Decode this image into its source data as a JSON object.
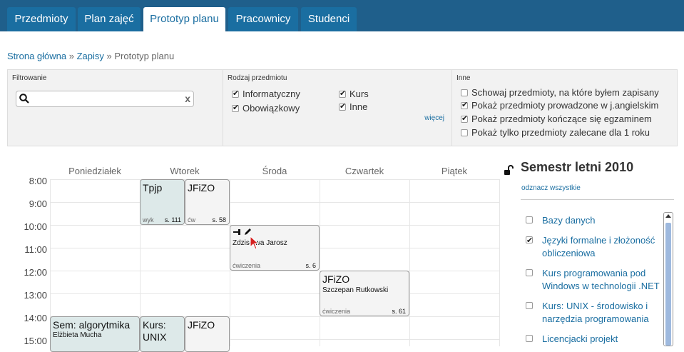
{
  "nav": {
    "tabs": [
      {
        "label": "Przedmioty"
      },
      {
        "label": "Plan zajęć"
      },
      {
        "label": "Prototyp planu"
      },
      {
        "label": "Pracownicy"
      },
      {
        "label": "Studenci"
      }
    ],
    "active": "Prototyp planu"
  },
  "breadcrumb": {
    "home": "Strona główna",
    "sep": "»",
    "enroll": "Zapisy",
    "current": "Prototyp planu"
  },
  "filters": {
    "search_title": "Filtrowanie",
    "search_value": "",
    "clear": "x",
    "type_title": "Rodzaj przedmiotu",
    "types": [
      {
        "label": "Informatyczny",
        "checked": true
      },
      {
        "label": "Obowiązkowy",
        "checked": true
      },
      {
        "label": "Kurs",
        "checked": true
      },
      {
        "label": "Inne",
        "checked": true
      }
    ],
    "more": "więcej",
    "other_title": "Inne",
    "other": [
      {
        "label": "Schowaj przedmioty, na które byłem zapisany",
        "checked": false
      },
      {
        "label": "Pokaż przedmioty prowadzone w j.angielskim",
        "checked": true
      },
      {
        "label": "Pokaż przedmioty kończące się egzaminem",
        "checked": true
      },
      {
        "label": "Pokaż tylko przedmioty zalecane dla 1 roku",
        "checked": false
      }
    ]
  },
  "schedule": {
    "days": [
      "Poniedziałek",
      "Wtorek",
      "Środa",
      "Czwartek",
      "Piątek"
    ],
    "hours": [
      "8:00",
      "9:00",
      "10:00",
      "11:00",
      "12:00",
      "13:00",
      "14:00",
      "15:00"
    ],
    "events": [
      {
        "title": "Tpjp",
        "person": "",
        "kind": "wyk",
        "room": "s. 111"
      },
      {
        "title": "JFiZO",
        "person": "",
        "kind": "ćw",
        "room": "s. 58"
      },
      {
        "title": "",
        "person": "Zdzisława Jarosz",
        "kind": "ćwiczenia",
        "room": "s. 6"
      },
      {
        "title": "JFiZO",
        "person": "Szczepan Rutkowski",
        "kind": "ćwiczenia",
        "room": "s. 61"
      },
      {
        "title": "Sem: algorytmika",
        "person": "Elżbieta Mucha",
        "kind": "",
        "room": ""
      },
      {
        "title": "Kurs: UNIX",
        "person": "",
        "kind": "",
        "room": ""
      },
      {
        "title": "JFiZO",
        "person": "",
        "kind": "",
        "room": ""
      }
    ]
  },
  "semester": {
    "title": "Semestr letni 2010",
    "unmark_all": "odznacz wszystkie",
    "subjects": [
      {
        "label": "Bazy danych",
        "checked": false
      },
      {
        "label": "Języki formalne i złożoność obliczeniowa",
        "checked": true
      },
      {
        "label": "Kurs programowania pod Windows w technologii .NET",
        "checked": false
      },
      {
        "label": "Kurs: UNIX - środowisko i narzędzia programowania",
        "checked": false
      },
      {
        "label": "Licencjacki projekt",
        "checked": false
      }
    ]
  },
  "colors": {
    "nav_bg": "#1f5f8b",
    "tab_bg": "#1a6ea1",
    "link": "#1a6ea1",
    "event_green": "#dde9e9",
    "event_gray": "#f4f4f4"
  }
}
